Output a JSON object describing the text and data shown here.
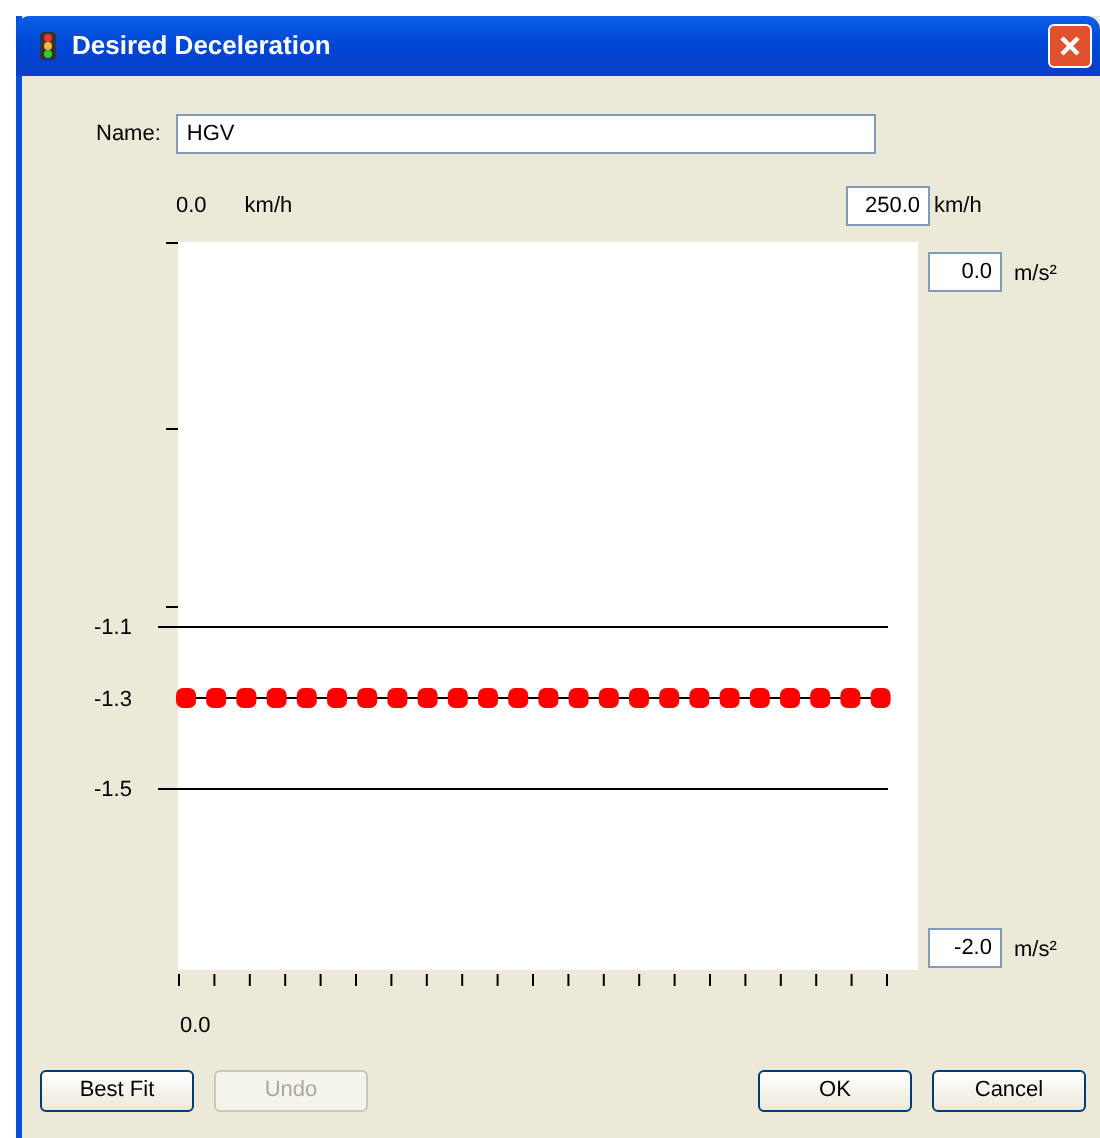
{
  "window": {
    "title": "Desired Deceleration"
  },
  "name_field": {
    "label": "Name:",
    "value": "HGV"
  },
  "speed_axis": {
    "min_label": "0.0",
    "min_unit": "km/h",
    "max_value": "250.0",
    "max_unit": "km/h",
    "bottom_label": "0.0"
  },
  "decel_axis": {
    "top_value": "0.0",
    "top_unit": "m/s²",
    "bottom_value": "-2.0",
    "bottom_unit": "m/s²"
  },
  "lines": [
    {
      "label": "-1.1",
      "kind": "bound"
    },
    {
      "label": "-1.3",
      "kind": "points"
    },
    {
      "label": "-1.5",
      "kind": "bound"
    }
  ],
  "left_buttons": [
    {
      "label": "Best Fit",
      "disabled": false
    },
    {
      "label": "Undo",
      "disabled": true
    }
  ],
  "right_buttons": [
    {
      "label": "OK",
      "disabled": false
    },
    {
      "label": "Cancel",
      "disabled": false
    }
  ]
}
